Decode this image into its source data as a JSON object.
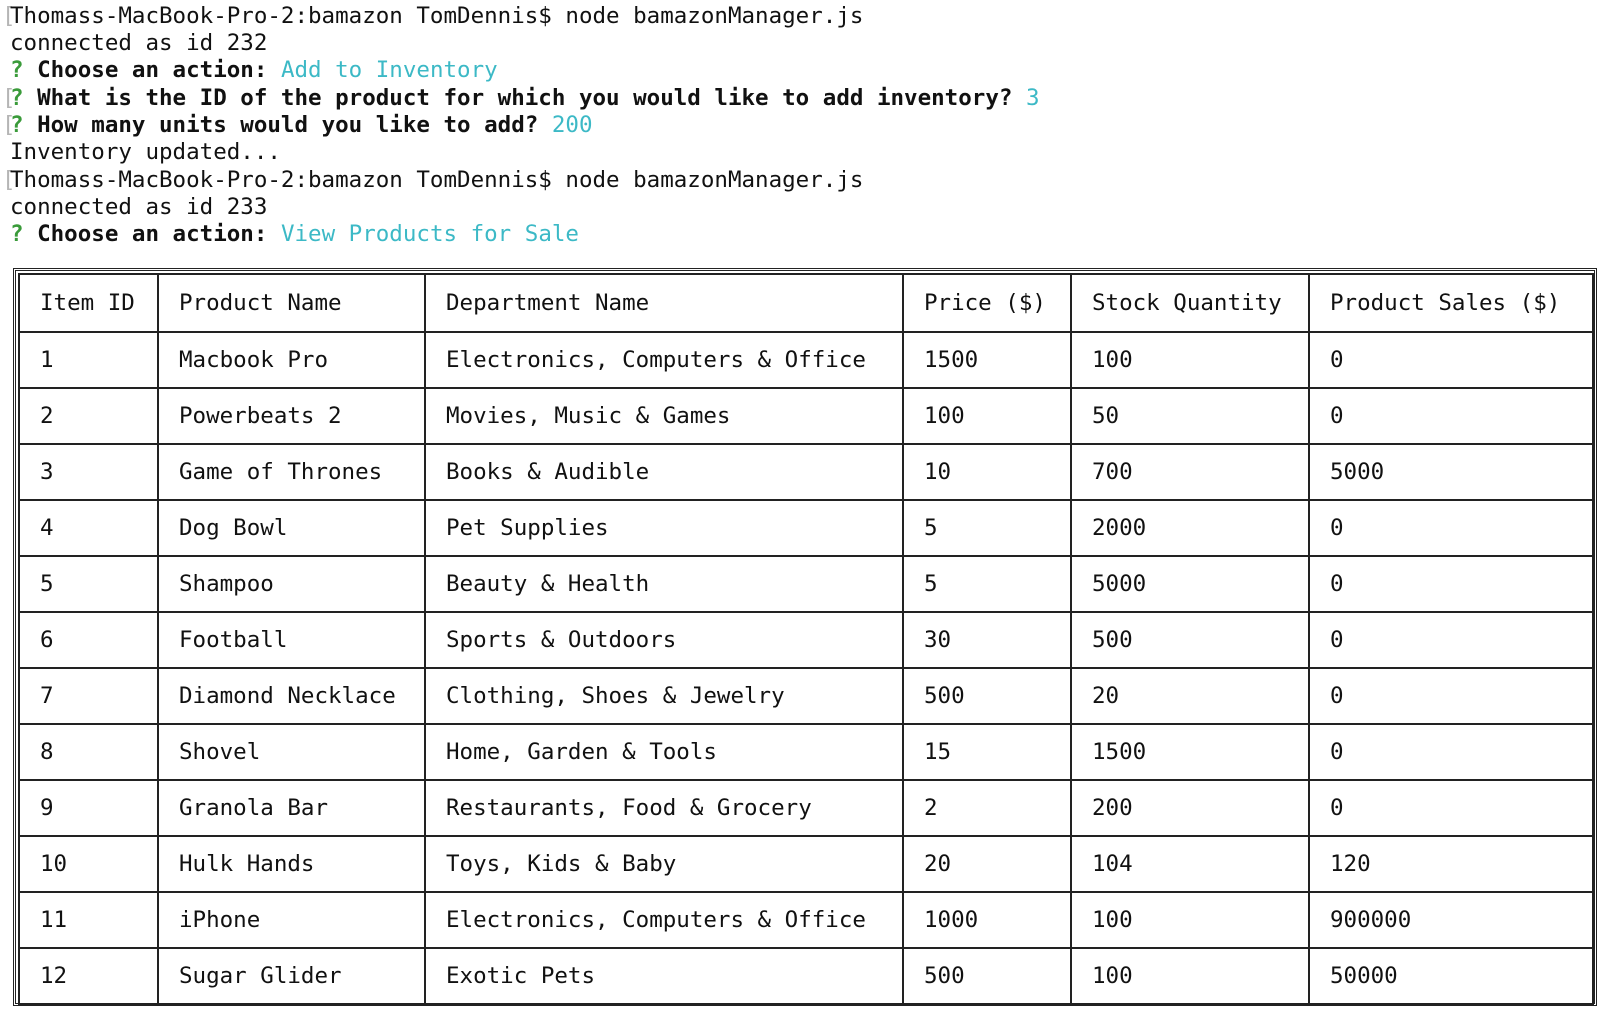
{
  "session": {
    "line1": "Thomass-MacBook-Pro-2:bamazon TomDennis$ node bamazonManager.js",
    "line2": "connected as id 232",
    "q1_label": "Choose an action:",
    "q1_answer": "Add to Inventory",
    "q2_label": "What is the ID of the product for which you would like to add inventory?",
    "q2_answer": "3",
    "q3_label": "How many units would you like to add?",
    "q3_answer": "200",
    "line6": "Inventory updated...",
    "line7": "Thomass-MacBook-Pro-2:bamazon TomDennis$ node bamazonManager.js",
    "line8": "connected as id 233",
    "q4_label": "Choose an action:",
    "q4_answer": "View Products for Sale",
    "prompt_marker": "?",
    "bracket": "["
  },
  "table": {
    "headers": [
      "Item ID",
      "Product Name",
      "Department Name",
      "Price ($)",
      "Stock Quantity",
      "Product Sales ($)"
    ],
    "rows": [
      [
        "1",
        "Macbook Pro",
        "Electronics, Computers & Office",
        "1500",
        "100",
        "0"
      ],
      [
        "2",
        "Powerbeats 2",
        "Movies, Music & Games",
        "100",
        "50",
        "0"
      ],
      [
        "3",
        "Game of Thrones",
        "Books & Audible",
        "10",
        "700",
        "5000"
      ],
      [
        "4",
        "Dog Bowl",
        "Pet Supplies",
        "5",
        "2000",
        "0"
      ],
      [
        "5",
        "Shampoo",
        "Beauty & Health",
        "5",
        "5000",
        "0"
      ],
      [
        "6",
        "Football",
        "Sports & Outdoors",
        "30",
        "500",
        "0"
      ],
      [
        "7",
        "Diamond Necklace",
        "Clothing, Shoes & Jewelry",
        "500",
        "20",
        "0"
      ],
      [
        "8",
        "Shovel",
        "Home, Garden & Tools",
        "15",
        "1500",
        "0"
      ],
      [
        "9",
        "Granola Bar",
        "Restaurants, Food & Grocery",
        "2",
        "200",
        "0"
      ],
      [
        "10",
        "Hulk Hands",
        "Toys, Kids & Baby",
        "20",
        "104",
        "120"
      ],
      [
        "11",
        "iPhone",
        "Electronics, Computers & Office",
        "1000",
        "100",
        "900000"
      ],
      [
        "12",
        "Sugar Glider",
        "Exotic Pets",
        "500",
        "100",
        "50000"
      ]
    ]
  },
  "colors": {
    "prompt_green": "#3a9b3a",
    "answer_cyan": "#3cb9c6",
    "text": "#111111",
    "background": "#ffffff"
  }
}
